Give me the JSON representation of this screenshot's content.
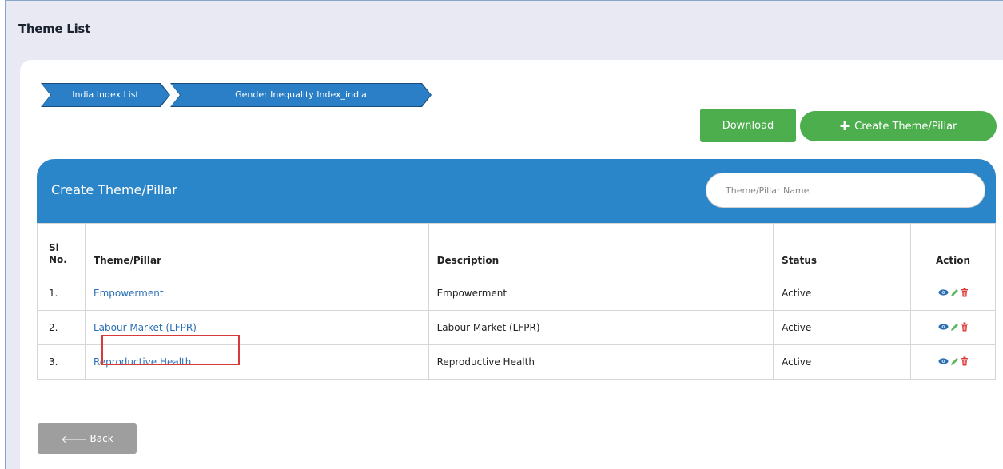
{
  "page": {
    "title": "Theme List"
  },
  "breadcrumb": [
    {
      "label": "India Index List"
    },
    {
      "label": "Gender Inequality Index_india"
    }
  ],
  "toolbar": {
    "download_label": "Download",
    "create_label": "Create Theme/Pillar",
    "create_icon": "plus-icon"
  },
  "panel": {
    "title": "Create Theme/Pillar",
    "search": {
      "placeholder": "Theme/Pillar Name",
      "value": ""
    }
  },
  "table": {
    "headers": [
      "Sl No.",
      "Theme/Pillar",
      "Description",
      "Status",
      "Action"
    ],
    "rows": [
      {
        "sl": "1.",
        "theme": "Empowerment",
        "description": "Empowerment",
        "status": "Active"
      },
      {
        "sl": "2.",
        "theme": "Labour Market (LFPR)",
        "description": "Labour Market (LFPR)",
        "status": "Active"
      },
      {
        "sl": "3.",
        "theme": "Reproductive Health",
        "description": "Reproductive Health",
        "status": "Active"
      }
    ],
    "action_icons": [
      "eye-icon",
      "pencil-icon",
      "trash-icon"
    ]
  },
  "footer": {
    "back_label": "Back",
    "back_icon": "arrow-left-icon"
  },
  "colors": {
    "primary_blue": "#2b86c9",
    "green": "#4cae4c",
    "link": "#2a6fb3",
    "highlight": "#d63a3a",
    "back_gray": "#9e9e9e"
  }
}
